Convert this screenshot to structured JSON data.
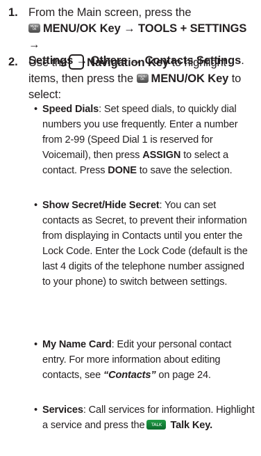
{
  "steps": [
    {
      "number": "1.",
      "intro": "From the Main screen, press the",
      "menu_key_icon_text": "MENU OK",
      "menu_key_label": "MENU/OK Key",
      "arrow": "→",
      "path_tools": "TOOLS + SETTINGS",
      "path_settings": "Settings",
      "path_others": "Others",
      "path_contacts": "Contacts Settings",
      "end": "."
    },
    {
      "number": "2.",
      "use_the": "Use the",
      "nav_key_label": "Navigation Key",
      "highlight_text": "to highlight items, then press the",
      "menu_key_icon_text": "MENU OK",
      "menu_key_label": "MENU/OK Key",
      "to_select": "to select:"
    }
  ],
  "bullets": [
    {
      "term": "Speed Dials",
      "text_a": ": Set speed dials, to quickly dial numbers you use frequently. Enter a number from 2-99 (Speed Dial 1 is reserved for Voicemail), then press",
      "assign": "ASSIGN",
      "text_b": "to select a contact. Press",
      "done": "DONE",
      "text_c": "to save the selection."
    },
    {
      "term": "Show Secret/Hide Secret",
      "text": ": You can set contacts as Secret, to prevent their information from displaying in Contacts until you enter the Lock Code. Enter the Lock Code (default is the last 4 digits of the telephone number assigned to your phone) to switch between settings."
    },
    {
      "term": "My Name Card",
      "text": ": Edit your personal contact entry. For more information about editing contacts, see",
      "xref": "“Contacts”",
      "page_ref": "on page 24."
    },
    {
      "term": "Services",
      "text": ": Call services for information. Highlight a service and press the",
      "talk_icon_text": "TALK",
      "talk_key_label": "Talk Key."
    }
  ],
  "bullet_symbol": "•"
}
